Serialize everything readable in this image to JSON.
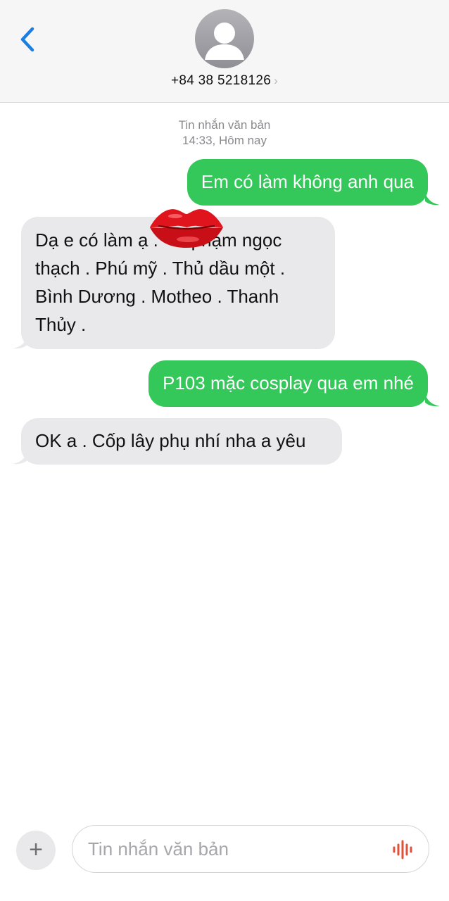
{
  "header": {
    "contact_number": "+84 38 5218126",
    "chevron": "›"
  },
  "thread": {
    "message_type": "Tin nhắn văn bản",
    "timestamp": "14:33, Hôm nay"
  },
  "messages": [
    {
      "direction": "outgoing",
      "text": "Em có làm không anh qua"
    },
    {
      "direction": "incoming",
      "text": "Dạ e có làm ạ . 🫦 phạm ngọc thạch . Phú mỹ . Thủ dầu một . Bình Dương . Motheo . Thanh Thủy ."
    },
    {
      "direction": "outgoing",
      "text": "P103 mặc cosplay qua em nhé"
    },
    {
      "direction": "incoming",
      "text": "OK a . Cốp lây phụ nhí nha a yêu"
    }
  ],
  "composer": {
    "placeholder": "Tin nhắn văn bản",
    "plus_label": "+"
  },
  "icons": {
    "back": "chevron-left-icon",
    "avatar": "person-icon",
    "overlay": "lips-icon",
    "voice": "waveform-icon"
  },
  "colors": {
    "outgoing_bubble": "#34c759",
    "incoming_bubble": "#e9e9eb",
    "accent": "#1a7fe0",
    "voice_icon": "#e1503a"
  }
}
